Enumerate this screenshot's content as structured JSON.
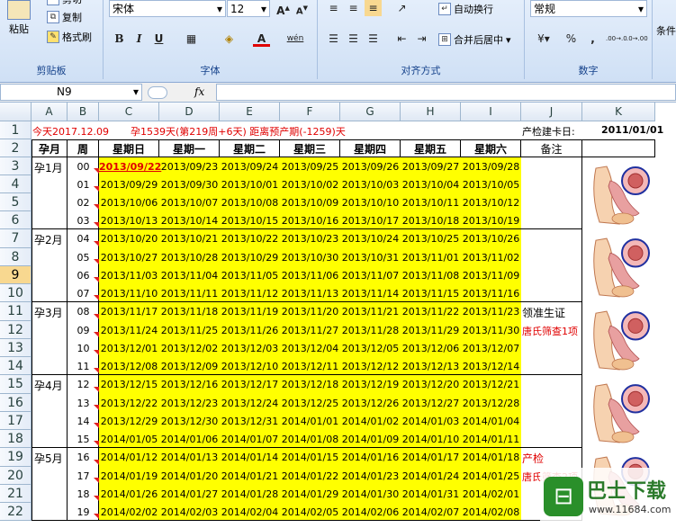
{
  "ribbon": {
    "clipboard": {
      "paste": "粘贴",
      "cut": "剪切",
      "copy": "复制",
      "format_painter": "格式刷",
      "label": "剪贴板"
    },
    "font": {
      "name": "宋体",
      "size": "12",
      "bold": "B",
      "italic": "I",
      "underline": "U",
      "label": "字体",
      "grow": "A",
      "shrink": "A",
      "phonetic": "wén"
    },
    "alignment": {
      "wrap": "自动换行",
      "merge": "合并后居中",
      "label": "对齐方式"
    },
    "number": {
      "format": "常规",
      "percent": "%",
      "comma": ",",
      "inc": ".00→.0",
      "dec": ".0→.00",
      "label": "数字"
    },
    "styles": {
      "cond": "条件"
    }
  },
  "formula_bar": {
    "name": "N9",
    "fx": "fx",
    "value": ""
  },
  "columns": [
    "A",
    "B",
    "C",
    "D",
    "E",
    "F",
    "G",
    "H",
    "I",
    "J",
    "K"
  ],
  "rows": [
    "1",
    "2",
    "3",
    "4",
    "5",
    "6",
    "7",
    "8",
    "9",
    "10",
    "11",
    "12",
    "13",
    "14",
    "15",
    "16",
    "17",
    "18",
    "19",
    "20",
    "21",
    "22"
  ],
  "selected_row": "9",
  "row1": {
    "today": "今天2017.12.09",
    "pregnancy": "孕1539天(第219周+6天) 距离预产期(-1259)天",
    "card_label": "产检建卡日:",
    "card_date": "2011/01/01"
  },
  "headers": {
    "month": "孕月",
    "week": "周",
    "days": [
      "星期日",
      "星期一",
      "星期二",
      "星期三",
      "星期四",
      "星期五",
      "星期六"
    ],
    "note": "备注"
  },
  "months": [
    "孕1月",
    "孕2月",
    "孕3月",
    "孕4月",
    "孕5月"
  ],
  "weeks": [
    "00",
    "01",
    "02",
    "03",
    "04",
    "05",
    "06",
    "07",
    "08",
    "09",
    "10",
    "11",
    "12",
    "13",
    "14",
    "15",
    "16",
    "17",
    "18",
    "19"
  ],
  "dates": [
    [
      "2013/09/22",
      "2013/09/23",
      "2013/09/24",
      "2013/09/25",
      "2013/09/26",
      "2013/09/27",
      "2013/09/28"
    ],
    [
      "2013/09/29",
      "2013/09/30",
      "2013/10/01",
      "2013/10/02",
      "2013/10/03",
      "2013/10/04",
      "2013/10/05"
    ],
    [
      "2013/10/06",
      "2013/10/07",
      "2013/10/08",
      "2013/10/09",
      "2013/10/10",
      "2013/10/11",
      "2013/10/12"
    ],
    [
      "2013/10/13",
      "2013/10/14",
      "2013/10/15",
      "2013/10/16",
      "2013/10/17",
      "2013/10/18",
      "2013/10/19"
    ],
    [
      "2013/10/20",
      "2013/10/21",
      "2013/10/22",
      "2013/10/23",
      "2013/10/24",
      "2013/10/25",
      "2013/10/26"
    ],
    [
      "2013/10/27",
      "2013/10/28",
      "2013/10/29",
      "2013/10/30",
      "2013/10/31",
      "2013/11/01",
      "2013/11/02"
    ],
    [
      "2013/11/03",
      "2013/11/04",
      "2013/11/05",
      "2013/11/06",
      "2013/11/07",
      "2013/11/08",
      "2013/11/09"
    ],
    [
      "2013/11/10",
      "2013/11/11",
      "2013/11/12",
      "2013/11/13",
      "2013/11/14",
      "2013/11/15",
      "2013/11/16"
    ],
    [
      "2013/11/17",
      "2013/11/18",
      "2013/11/19",
      "2013/11/20",
      "2013/11/21",
      "2013/11/22",
      "2013/11/23"
    ],
    [
      "2013/11/24",
      "2013/11/25",
      "2013/11/26",
      "2013/11/27",
      "2013/11/28",
      "2013/11/29",
      "2013/11/30"
    ],
    [
      "2013/12/01",
      "2013/12/02",
      "2013/12/03",
      "2013/12/04",
      "2013/12/05",
      "2013/12/06",
      "2013/12/07"
    ],
    [
      "2013/12/08",
      "2013/12/09",
      "2013/12/10",
      "2013/12/11",
      "2013/12/12",
      "2013/12/13",
      "2013/12/14"
    ],
    [
      "2013/12/15",
      "2013/12/16",
      "2013/12/17",
      "2013/12/18",
      "2013/12/19",
      "2013/12/20",
      "2013/12/21"
    ],
    [
      "2013/12/22",
      "2013/12/23",
      "2013/12/24",
      "2013/12/25",
      "2013/12/26",
      "2013/12/27",
      "2013/12/28"
    ],
    [
      "2013/12/29",
      "2013/12/30",
      "2013/12/31",
      "2014/01/01",
      "2014/01/02",
      "2014/01/03",
      "2014/01/04"
    ],
    [
      "2014/01/05",
      "2014/01/06",
      "2014/01/07",
      "2014/01/08",
      "2014/01/09",
      "2014/01/10",
      "2014/01/11"
    ],
    [
      "2014/01/12",
      "2014/01/13",
      "2014/01/14",
      "2014/01/15",
      "2014/01/16",
      "2014/01/17",
      "2014/01/18"
    ],
    [
      "2014/01/19",
      "2014/01/20",
      "2014/01/21",
      "2014/01/22",
      "2014/01/23",
      "2014/01/24",
      "2014/01/25"
    ],
    [
      "2014/01/26",
      "2014/01/27",
      "2014/01/28",
      "2014/01/29",
      "2014/01/30",
      "2014/01/31",
      "2014/02/01"
    ],
    [
      "2014/02/02",
      "2014/02/03",
      "2014/02/04",
      "2014/02/05",
      "2014/02/06",
      "2014/02/07",
      "2014/02/08"
    ]
  ],
  "notes": {
    "m3a": "领准生证",
    "m3b": "唐氏筛查1项",
    "m5a": "产检",
    "m5b": "唐氏筛查2项"
  },
  "watermark": {
    "name": "巴士下载",
    "url": "www.11684.com"
  },
  "colors": {
    "highlight": "#ffff00",
    "red": "#e00000"
  }
}
